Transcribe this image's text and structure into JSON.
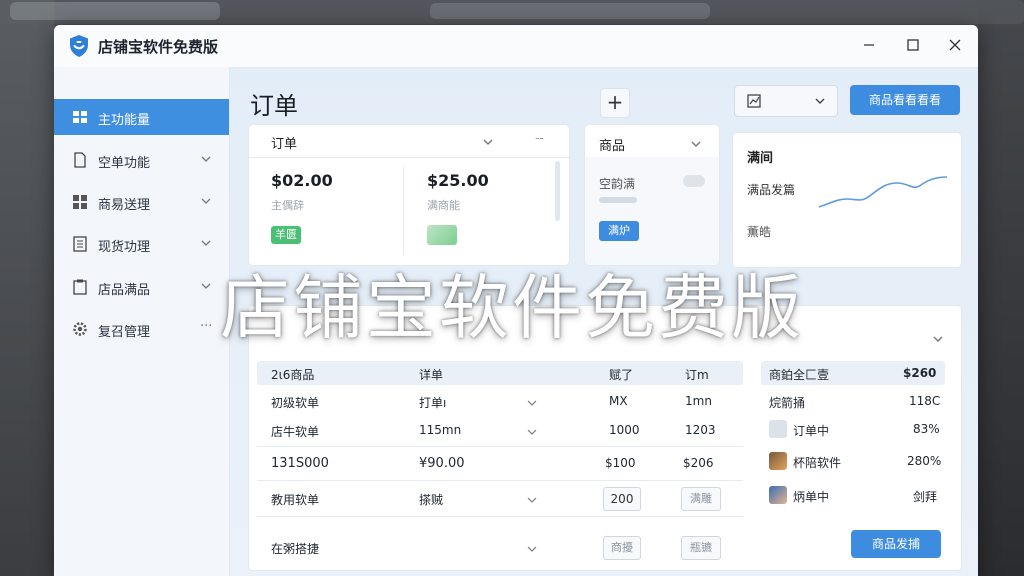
{
  "window": {
    "title": "店铺宝软件免费版"
  },
  "overlay_title": "店铺宝软件免费版",
  "sidebar": {
    "items": [
      {
        "label": "主功能量",
        "icon": "grid-icon",
        "active": true
      },
      {
        "label": "空单功能",
        "icon": "document-icon"
      },
      {
        "label": "商易送理",
        "icon": "apps-icon"
      },
      {
        "label": "现货功理",
        "icon": "list-icon"
      },
      {
        "label": "店品满品",
        "icon": "clipboard-icon"
      },
      {
        "label": "复召管理",
        "icon": "gear-icon"
      }
    ]
  },
  "header": {
    "title": "订单",
    "primary_button": "商品看看看看"
  },
  "order_card": {
    "title": "订单",
    "stats": [
      {
        "amount": "$02.00",
        "sub": "主偶辞",
        "tag": "羊匮"
      },
      {
        "amount": "$25.00",
        "sub": "满商能"
      }
    ]
  },
  "product_card": {
    "title": "商品",
    "toggle_label": "空韵满",
    "button": "满炉"
  },
  "trend_card": {
    "title": "满间",
    "row1": "满品发篇",
    "row2": "薫皓"
  },
  "table": {
    "header": [
      "2ι6商品",
      "详单",
      "赋了",
      "订m"
    ],
    "rows": [
      [
        "初级软单",
        "打单ı",
        "MX",
        "1mn"
      ],
      [
        "店牛软单",
        "115mn",
        "1000",
        "1203"
      ],
      [
        "131S000",
        "¥90.00",
        "$100",
        "$206"
      ]
    ],
    "row4_label": "教用软单",
    "row4_col2": "搽贼",
    "row4_input": "200",
    "row4_button": "满雕",
    "row5_label": "在粥搭捷",
    "row5_btn1": "商擾",
    "row5_btn2": "瓶镳"
  },
  "right_list": {
    "header": [
      "商鉑全匚壹",
      "$260"
    ],
    "rows": [
      {
        "name": "烷箭捅",
        "value": "118C"
      },
      {
        "name": "订单中",
        "value": "83%"
      },
      {
        "name": "杯陪软件",
        "value": "280%"
      },
      {
        "name": "炳单中",
        "value": "剑拜"
      }
    ],
    "button": "商品发捕"
  },
  "colors": {
    "accent": "#3d8ce0",
    "tag_green": "#4bbf73"
  }
}
